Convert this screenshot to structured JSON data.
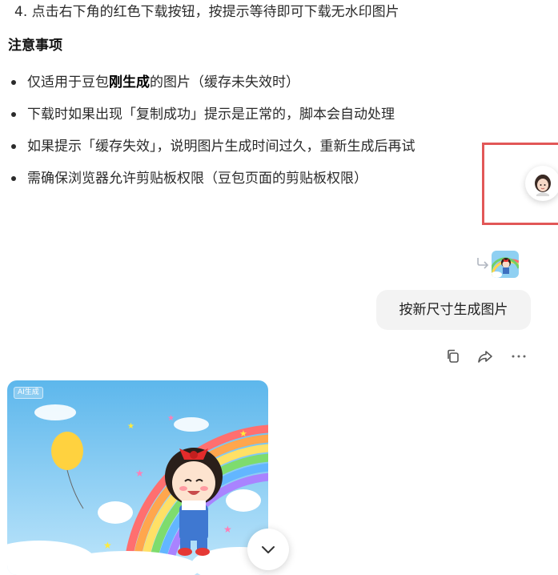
{
  "instructions": {
    "step4": "4. 点击右下角的红色下载按钮，按提示等待即可下载无水印图片"
  },
  "notes": {
    "heading": "注意事项",
    "items": [
      {
        "pre": "仅适用于豆包",
        "bold": "刚生成",
        "post": "的图片（缓存未失效时）"
      },
      {
        "pre": "下载时如果出现「复制成功」提示是正常的，脚本会自动处理",
        "bold": "",
        "post": ""
      },
      {
        "pre": "如果提示「缓存失效」，说明图片生成时间过久，重新生成后再试",
        "bold": "",
        "post": ""
      },
      {
        "pre": "需确保浏览器允许剪贴板权限（豆包页面的剪贴板权限）",
        "bold": "",
        "post": ""
      }
    ]
  },
  "user_message": {
    "text": "按新尺寸生成图片",
    "has_reference_image": true
  },
  "message_actions": {
    "icons": [
      "copy-icon",
      "share-icon",
      "more-icon"
    ]
  },
  "generated_image": {
    "tag": "AI生成"
  },
  "colors": {
    "highlight": "#e25757",
    "bubble_bg": "#f3f3f3",
    "text": "#1f1f1f"
  }
}
